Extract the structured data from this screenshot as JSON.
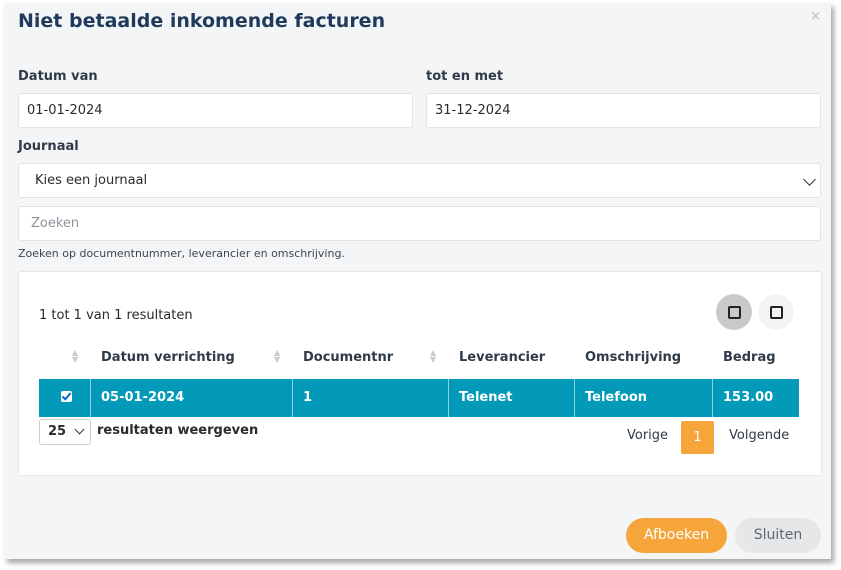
{
  "dialog": {
    "title": "Niet betaalde inkomende facturen",
    "close_icon": "×"
  },
  "filters": {
    "datum_van_label": "Datum van",
    "datum_van_value": "01-01-2024",
    "tot_en_met_label": "tot en met",
    "tot_en_met_value": "31-12-2024",
    "journaal_label": "Journaal",
    "journaal_value": "Kies een journaal",
    "search_placeholder": "Zoeken",
    "search_hint": "Zoeken op documentnummer, leverancier en omschrijving."
  },
  "table": {
    "results_text": "1 tot 1 van 1 resultaten",
    "columns": [
      "Datum verrichting",
      "Documentnr",
      "Leverancier",
      "Omschrijving",
      "Bedrag"
    ],
    "rows": [
      {
        "checked": true,
        "datum": "05-01-2024",
        "documentnr": "1",
        "leverancier": "Telenet",
        "omschrijving": "Telefoon",
        "bedrag": "153.00"
      }
    ],
    "selected_row_color": "#0399b8"
  },
  "pagination": {
    "page_size": "25",
    "page_size_label": "resultaten weergeven",
    "prev_label": "Vorige",
    "current_page": "1",
    "next_label": "Volgende",
    "accent_color": "#f5a53a"
  },
  "footer": {
    "primary_label": "Afboeken",
    "secondary_label": "Sluiten"
  }
}
